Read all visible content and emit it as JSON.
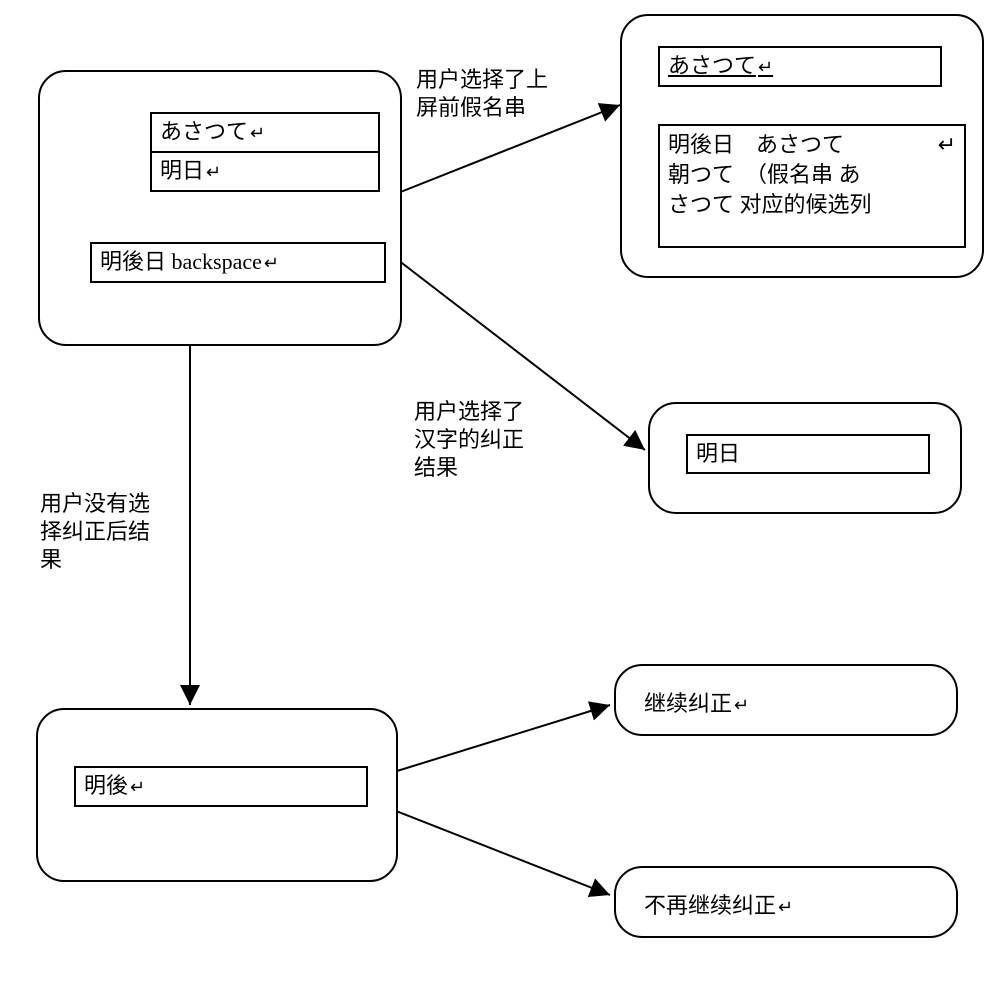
{
  "box_main": {
    "row1": "あさつて",
    "row2": "明日",
    "row3": "明後日 backspace"
  },
  "box_top_right": {
    "header": "あさつて",
    "list_line1": "明後日　あさつて",
    "list_line2": "朝つて　（假名串 あ",
    "list_line3": "さつて 对应的候选列"
  },
  "box_mid_right": {
    "text": "明日"
  },
  "box_bottom_left": {
    "text": "明後"
  },
  "box_r1": {
    "text": "继续纠正"
  },
  "box_r2": {
    "text": "不再继续纠正"
  },
  "label_top": "用户选择了上\n屏前假名串",
  "label_mid": "用户选择了\n汉字的纠正\n结果",
  "label_left": "用户没有选\n择纠正后结\n果"
}
